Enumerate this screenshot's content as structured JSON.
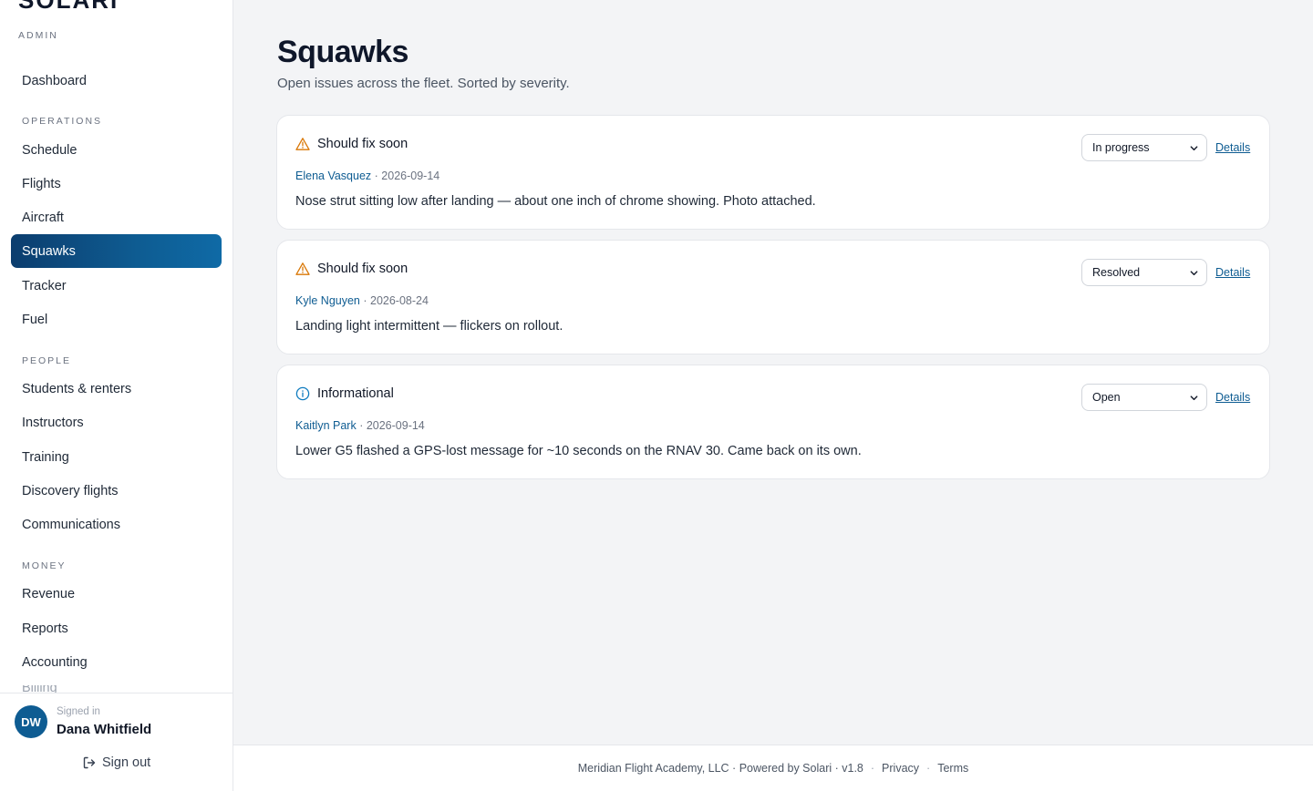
{
  "brand": {
    "name": "SOLARI",
    "subtitle": "ADMIN"
  },
  "nav": {
    "top": [
      {
        "label": "Dashboard"
      }
    ],
    "sections": [
      {
        "title": "OPERATIONS",
        "items": [
          "Schedule",
          "Flights",
          "Aircraft",
          "Squawks",
          "Tracker",
          "Fuel"
        ]
      },
      {
        "title": "PEOPLE",
        "items": [
          "Students & renters",
          "Instructors",
          "Training",
          "Discovery flights",
          "Communications"
        ]
      },
      {
        "title": "MONEY",
        "items": [
          "Revenue",
          "Reports",
          "Accounting",
          "Billing"
        ]
      }
    ],
    "active": "Squawks"
  },
  "user": {
    "initials": "DW",
    "signed_label": "Signed in",
    "name": "Dana Whitfield",
    "signout_label": "Sign out"
  },
  "page": {
    "title": "Squawks",
    "subtitle": "Open issues across the fleet. Sorted by severity."
  },
  "squawks": [
    {
      "severity": "Should fix soon",
      "severity_icon": "warning-triangle-icon",
      "author": "Elena Vasquez",
      "date": "· 2026-09-14",
      "description": "Nose strut sitting low after landing — about one inch of chrome showing. Photo attached.",
      "status": "In progress",
      "details_label": "Details"
    },
    {
      "severity": "Should fix soon",
      "severity_icon": "warning-triangle-icon",
      "author": "Kyle Nguyen",
      "date": "· 2026-08-24",
      "description": "Landing light intermittent — flickers on rollout.",
      "status": "Resolved",
      "details_label": "Details"
    },
    {
      "severity": "Informational",
      "severity_icon": "info-circle-icon",
      "author": "Kaitlyn Park",
      "date": "· 2026-09-14",
      "description": "Lower G5 flashed a GPS-lost message for ~10 seconds on the RNAV 30. Came back on its own.",
      "status": "Open",
      "details_label": "Details"
    }
  ],
  "footer": {
    "company": "Meridian Flight Academy, LLC · Powered by Solari · v1.8",
    "privacy": "Privacy",
    "terms": "Terms",
    "separator": "·"
  },
  "colors": {
    "accent": "#0e5c92",
    "warning": "#d97706",
    "info": "#0e7bbf"
  }
}
